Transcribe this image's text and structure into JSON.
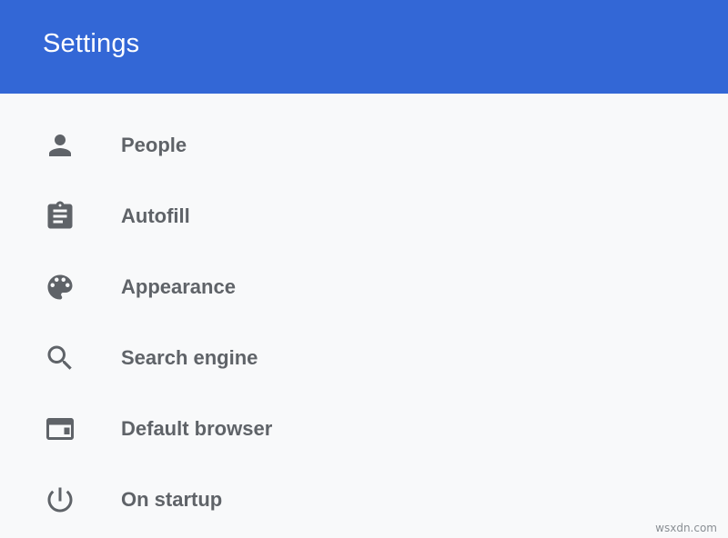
{
  "header": {
    "title": "Settings",
    "background_color": "#3367d6"
  },
  "menu": {
    "items": [
      {
        "label": "People",
        "icon": "person-icon"
      },
      {
        "label": "Autofill",
        "icon": "clipboard-icon"
      },
      {
        "label": "Appearance",
        "icon": "palette-icon"
      },
      {
        "label": "Search engine",
        "icon": "search-icon"
      },
      {
        "label": "Default browser",
        "icon": "browser-window-icon"
      },
      {
        "label": "On startup",
        "icon": "power-icon"
      }
    ],
    "label_color": "#5f6368",
    "icon_color": "#5f6368"
  },
  "watermark": {
    "text": "wsxdn.com"
  }
}
